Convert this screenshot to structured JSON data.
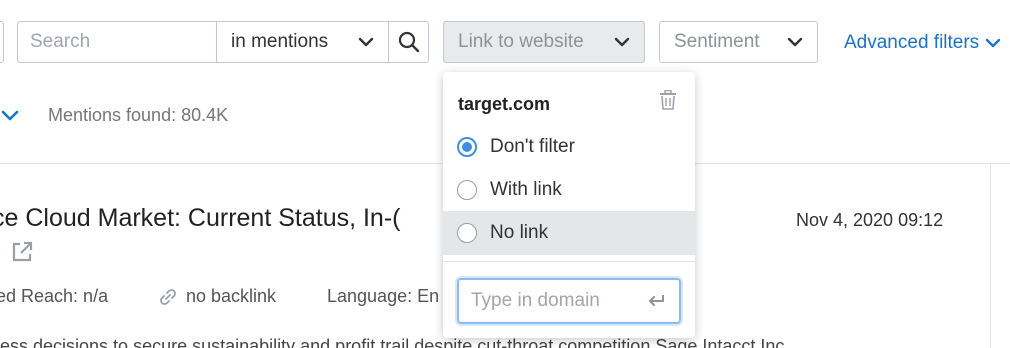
{
  "filters": {
    "search_placeholder": "Search",
    "scope_value": "in mentions",
    "link_dropdown": "Link to website",
    "sentiment_dropdown": "Sentiment",
    "advanced_filters": "Advanced filters"
  },
  "results": {
    "mentions_found": "Mentions found: 80.4K"
  },
  "article": {
    "title_fragment": "ce Cloud Market: Current Status, In-(",
    "date": "Nov 4, 2020 09:12",
    "reach": "ed Reach: n/a",
    "backlink": "no backlink",
    "language": "Language: En",
    "snippet": "ess decisions to secure sustainability and profit trail despite cut-throat competition Sage Intacct Inc"
  },
  "popover": {
    "title": "target.com",
    "options": [
      {
        "label": "Don't filter",
        "selected": true
      },
      {
        "label": "With link",
        "selected": false
      },
      {
        "label": "No link",
        "selected": false
      }
    ],
    "domain_placeholder": "Type in domain"
  },
  "colors": {
    "accent_blue": "#1a73c8",
    "radio_selected": "#3f8ee2",
    "border": "#c4c7cf"
  },
  "icons": {
    "search": "search-icon",
    "chevron": "chevron-down-icon",
    "trash": "trash-icon",
    "external": "external-link-icon",
    "link": "link-icon",
    "enter": "enter-icon"
  }
}
